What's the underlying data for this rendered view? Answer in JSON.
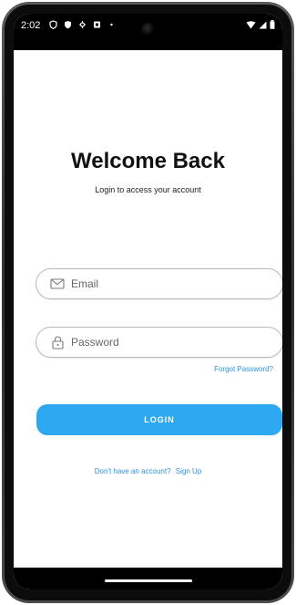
{
  "status_bar": {
    "time": "2:02",
    "icons_left": [
      "shield-outline-icon",
      "shield-icon",
      "settings-icon",
      "square-icon",
      "dot-icon"
    ],
    "icons_right": [
      "wifi-icon",
      "signal-icon",
      "battery-icon"
    ]
  },
  "header": {
    "title": "Welcome Back",
    "subtitle": "Login to access your account"
  },
  "form": {
    "email_placeholder": "Email",
    "password_placeholder": "Password",
    "forgot_password": "Forgot Password?",
    "login_label": "LOGIN"
  },
  "footer": {
    "prompt": "Don't have an account?",
    "signup_label": "Sign Up"
  },
  "colors": {
    "accent": "#2fa8f2",
    "link": "#2d93e6",
    "title_text": "#111111"
  }
}
